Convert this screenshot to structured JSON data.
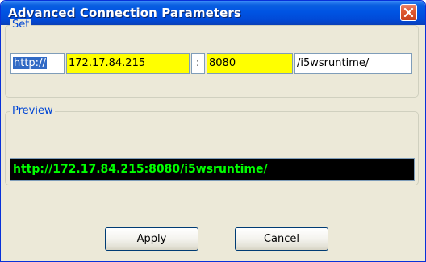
{
  "window": {
    "title": "Advanced Connection Parameters"
  },
  "set_group": {
    "legend": "Set",
    "protocol": "http://",
    "host": "172.17.84.215",
    "separator": ":",
    "port": "8080",
    "path": "/i5wsruntime/"
  },
  "preview_group": {
    "legend": "Preview",
    "url": "http://172.17.84.215:8080/i5wsruntime/"
  },
  "buttons": {
    "apply": "Apply",
    "cancel": "Cancel"
  },
  "colors": {
    "highlight_field": "#ffff00",
    "preview_background": "#000000",
    "preview_text": "#00ff00",
    "titlebar": "#0054e3"
  },
  "icons": {
    "close": "close-icon"
  }
}
